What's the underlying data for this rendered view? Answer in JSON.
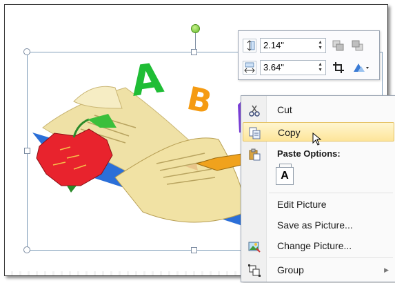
{
  "mini_toolbar": {
    "height_value": "2.14\"",
    "width_value": "3.64\"",
    "height_icon": "shape-height-icon",
    "width_icon": "shape-width-icon",
    "bring_forward_icon": "bring-forward-icon",
    "send_backward_icon": "send-backward-icon",
    "crop_icon": "crop-icon",
    "picture_styles_icon": "picture-styles-icon"
  },
  "context_menu": {
    "cut": "Cut",
    "copy": "Copy",
    "paste_options": "Paste Options:",
    "paste_keep_text": "A",
    "edit_picture": "Edit Picture",
    "save_as_picture": "Save as Picture...",
    "change_picture": "Change Picture...",
    "group": "Group",
    "hovered_item": "Copy"
  },
  "clipart": {
    "letter_a": "A",
    "letter_b": "B"
  },
  "colors": {
    "hover_fill": "#fde59a",
    "rotation_handle": "#5fb82a",
    "selection_border": "#7f9db9"
  }
}
